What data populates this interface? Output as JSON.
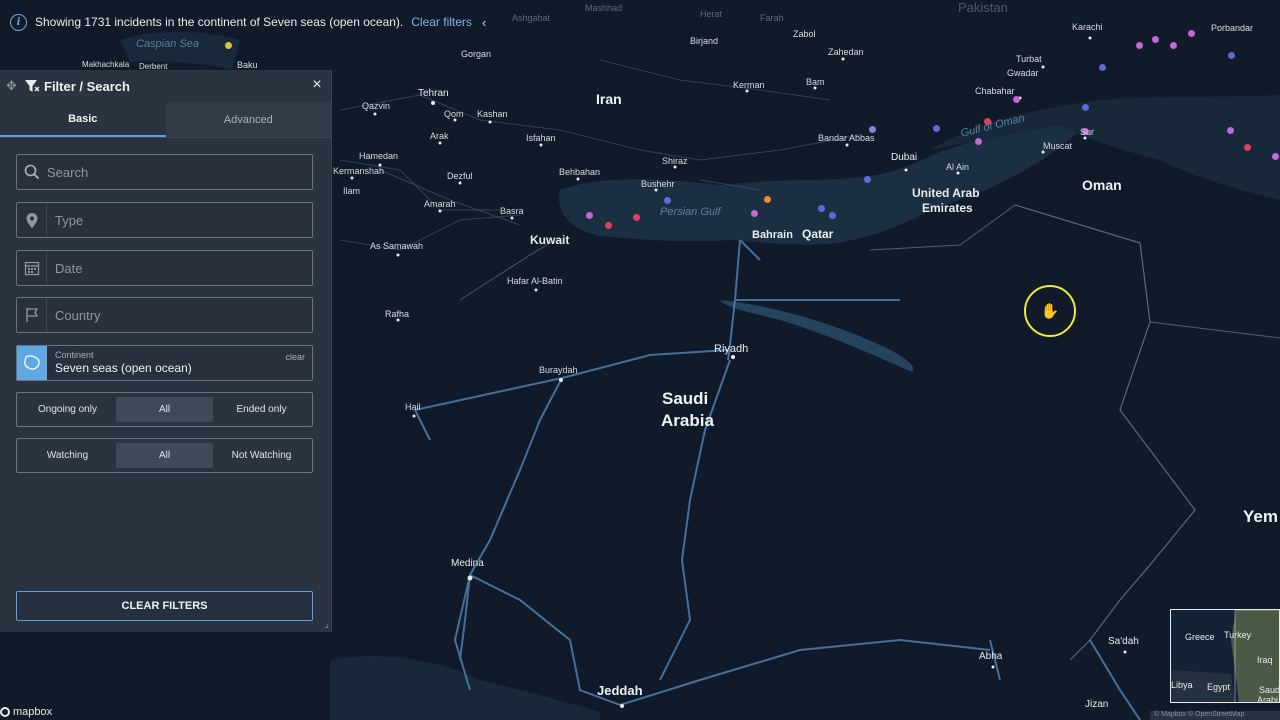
{
  "info_bar": {
    "icon": "info-icon",
    "message": "Showing 1731 incidents in the continent of Seven seas (open ocean).",
    "clear_link": "Clear filters",
    "collapse": "‹"
  },
  "panel": {
    "title": "Filter / Search",
    "close": "×",
    "tabs": [
      {
        "label": "Basic",
        "active": true
      },
      {
        "label": "Advanced",
        "active": false
      }
    ],
    "search_placeholder": "Search",
    "type_placeholder": "Type",
    "date_placeholder": "Date",
    "country_placeholder": "Country",
    "continent": {
      "caption": "Continent",
      "value": "Seven seas (open ocean)",
      "clear": "clear"
    },
    "status_options": [
      {
        "label": "Ongoing only",
        "selected": false
      },
      {
        "label": "All",
        "selected": true
      },
      {
        "label": "Ended only",
        "selected": false
      }
    ],
    "watch_options": [
      {
        "label": "Watching",
        "selected": false
      },
      {
        "label": "All",
        "selected": true
      },
      {
        "label": "Not Watching",
        "selected": false
      }
    ],
    "clear_button": "CLEAR FILTERS"
  },
  "map": {
    "countries": {
      "iran": "Iran",
      "oman": "Oman",
      "kuwait": "Kuwait",
      "bahrain": "Bahrain",
      "qatar": "Qatar",
      "uae_1": "United Arab",
      "uae_2": "Emirates",
      "saudi_1": "Saudi",
      "saudi_2": "Arabia",
      "yemen": "Yem"
    },
    "water": {
      "caspian": "Caspian Sea",
      "persian_gulf": "Persian Gulf",
      "gulf_of_oman": "Gulf of Oman"
    },
    "cities": {
      "tehran": "Tehran",
      "qazvin": "Qazvin",
      "qom": "Qom",
      "kashan": "Kashan",
      "arak": "Arak",
      "isfahan": "Isfahan",
      "hamedan": "Hamedan",
      "kermanshah": "Kermanshah",
      "ilam": "Ilam",
      "dezful": "Dezful",
      "behbahan": "Behbahan",
      "amarah": "Amarah",
      "basra": "Basra",
      "as_samawah": "As Samawah",
      "hafar": "Hafar Al-Batin",
      "rafha": "Rafha",
      "shiraz": "Shiraz",
      "bushehr": "Bushehr",
      "kerman": "Kerman",
      "bam": "Bam",
      "zahedan": "Zahedan",
      "zabol": "Zabol",
      "birjand": "Birjand",
      "bandar_abbas": "Bandar Abbas",
      "dubai": "Dubai",
      "al_ain": "Al Ain",
      "muscat": "Muscat",
      "sur": "Sur",
      "chabahar": "Chabahar",
      "gwadar": "Gwadar",
      "turbat": "Turbat",
      "karachi": "Karachi",
      "portbandar": "Porbandar",
      "riyadh": "Riyadh",
      "buraydah": "Buraydah",
      "hail": "Hail",
      "medina": "Medina",
      "jeddah": "Jeddah",
      "abha": "Abha",
      "sadah": "Sa'dah",
      "jizan": "Jizan",
      "makhachkala": "Makhachkala",
      "derbent": "Derbent",
      "baku": "Baku",
      "gorgan": "Gorgan",
      "ashgabat": "Ashgabat",
      "mashhad": "Mashhad",
      "herat": "Herat",
      "farah": "Farah",
      "pakistan": "Pakistan"
    }
  },
  "minimap": {
    "labels": {
      "greece": "Greece",
      "turkey": "Turkey",
      "iraq": "Iraq",
      "libya": "Libya",
      "egypt": "Egypt",
      "saudi": "Saud",
      "saudi2": "Arabi"
    }
  },
  "attribution": {
    "logo": "mapbox",
    "text": "© Mapbox © OpenStreetMap"
  },
  "colors": {
    "accent": "#5aa2e0",
    "road": "#4f7fae",
    "panel_bg": "#2a3340",
    "map_bg": "#0f1726",
    "cursor_ring": "#ecec3a"
  }
}
